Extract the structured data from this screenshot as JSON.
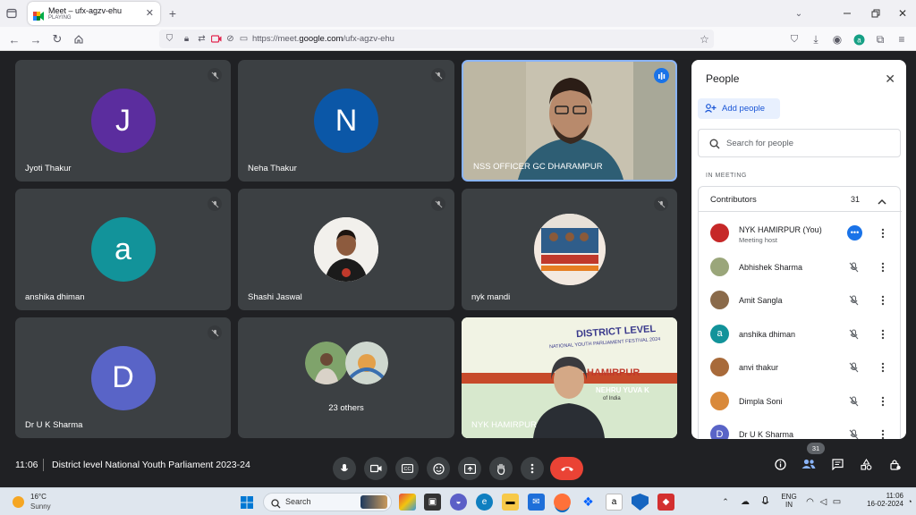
{
  "browser": {
    "tab_title": "Meet – ufx-agzv-ehu",
    "tab_status": "PLAYING",
    "url_prefix": "https://meet.",
    "url_domain": "google.com",
    "url_path": "/ufx-agzv-ehu"
  },
  "tiles": [
    {
      "name": "Jyoti Thakur",
      "initial": "J",
      "color": "#5b2d9e",
      "muted": true
    },
    {
      "name": "Neha Thakur",
      "initial": "N",
      "color": "#0b57a7",
      "muted": true
    },
    {
      "name": "NSS OFFICER GC DHARAMPUR",
      "speaking": true
    },
    {
      "name": "anshika dhiman",
      "initial": "a",
      "color": "#12939a",
      "muted": true
    },
    {
      "name": "Shashi Jaswal",
      "muted": true
    },
    {
      "name": "nyk mandi",
      "muted": true
    },
    {
      "name": "Dr U K Sharma",
      "initial": "D",
      "color": "#5964c7",
      "muted": true
    },
    {
      "name": "23 others"
    },
    {
      "name": "NYK HAMIRPUR"
    }
  ],
  "banner_text": {
    "line1": "DISTRICT LEVEL",
    "line2": "NATIONAL YOUTH PARLIAMENT FESTIVAL 2024",
    "line3": "HAMIRPUR",
    "line4": "NEHRU YUVA K",
    "line5": "of India"
  },
  "people_panel": {
    "title": "People",
    "add_people": "Add people",
    "search_placeholder": "Search for people",
    "section_label": "IN MEETING",
    "group_label": "Contributors",
    "group_count": "31",
    "participants": [
      {
        "name": "NYK HAMIRPUR (You)",
        "sub": "Meeting host",
        "avatar_color": "#c62828"
      },
      {
        "name": "Abhishek Sharma",
        "avatar_color": "#9aa67a"
      },
      {
        "name": "Amit Sangla",
        "avatar_color": "#8a6a4a"
      },
      {
        "name": "anshika dhiman",
        "initial": "a",
        "avatar_color": "#12939a"
      },
      {
        "name": "anvi thakur",
        "avatar_color": "#a86a3a"
      },
      {
        "name": "Dimpla Soni",
        "avatar_color": "#d9893a"
      },
      {
        "name": "Dr U K Sharma",
        "initial": "D",
        "avatar_color": "#5964c7"
      }
    ]
  },
  "bottom": {
    "time": "11:06",
    "meeting_title": "District level National Youth Parliament 2023-24",
    "people_badge": "31"
  },
  "taskbar": {
    "weather_temp": "16°C",
    "weather_desc": "Sunny",
    "search_label": "Search",
    "lang": "ENG",
    "region": "IN",
    "clock_time": "11:06",
    "clock_date": "16-02-2024"
  }
}
